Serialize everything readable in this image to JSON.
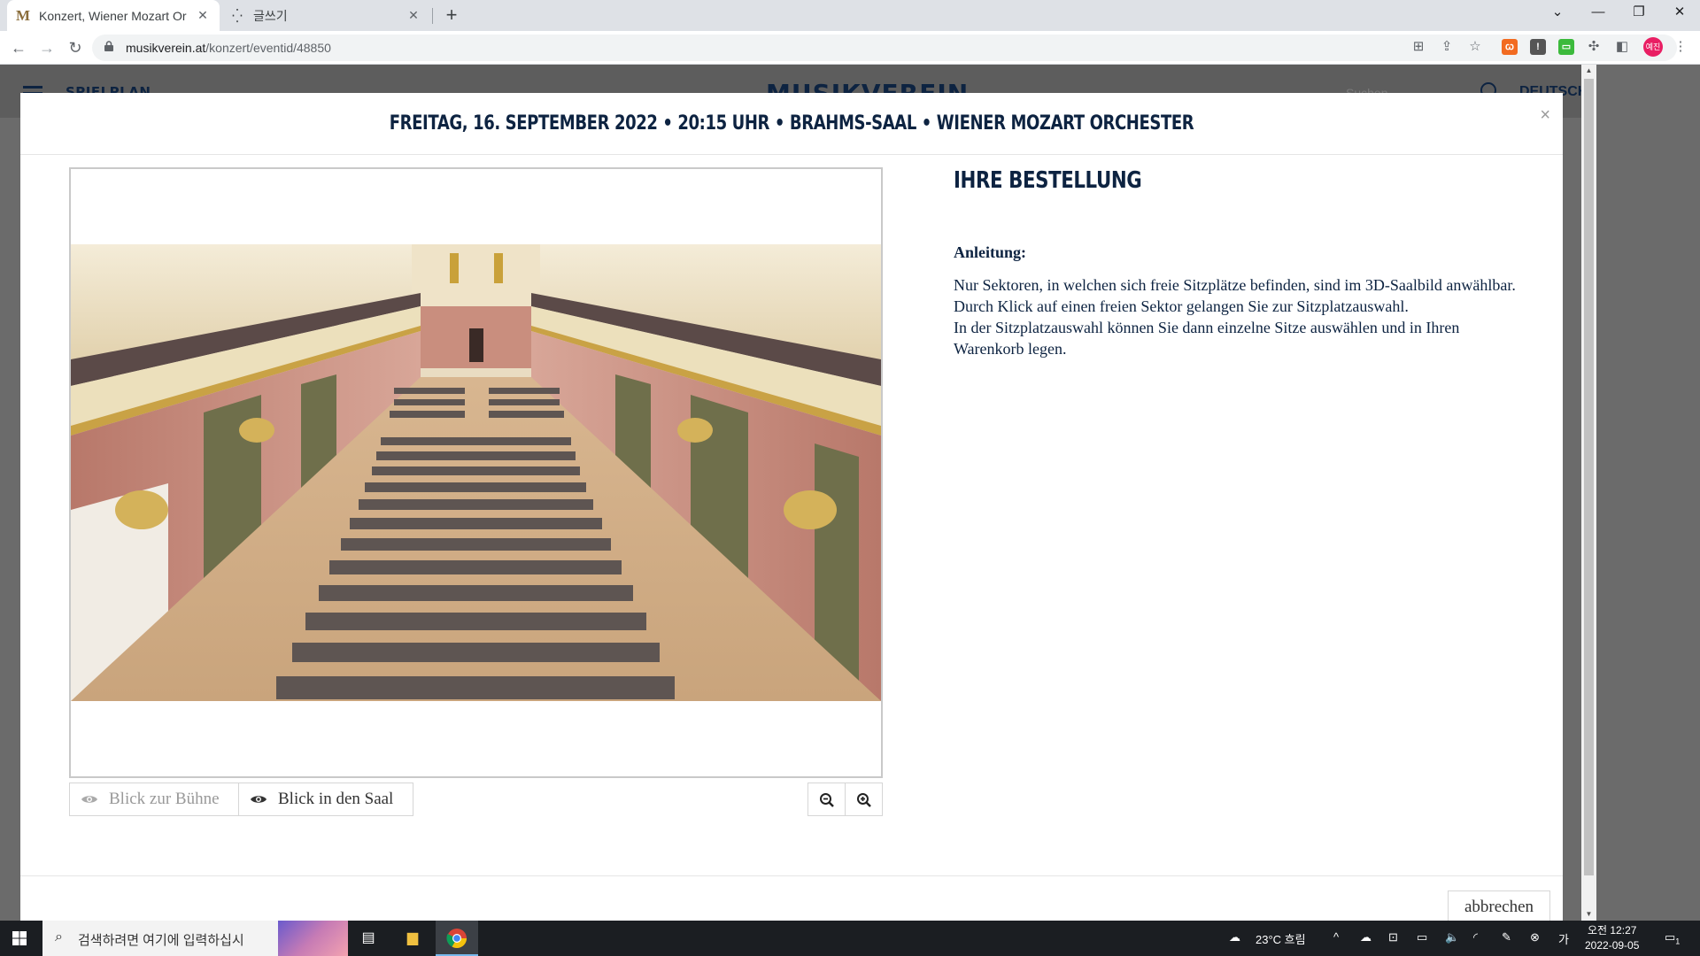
{
  "browser": {
    "tabs": [
      {
        "title": "Konzert, Wiener Mozart Or",
        "favicon": "M",
        "active": true
      },
      {
        "title": "글쓰기",
        "favicon": "⁛",
        "active": false
      }
    ],
    "url_host": "musikverein.at",
    "url_path": "/konzert/eventid/48850",
    "profile_label": "예진"
  },
  "site": {
    "menu_label": "SPIELPLAN",
    "logo": "MUSIKVEREIN",
    "search_placeholder": "Suchen",
    "language": "DEUTSCH"
  },
  "modal": {
    "title": "FREITAG, 16. SEPTEMBER 2022 • 20:15 UHR • BRAHMS-SAAL • WIENER MOZART ORCHESTER",
    "close": "×",
    "view_stage_label": "Blick zur Bühne",
    "view_hall_label": "Blick in den Saal",
    "order_heading": "IHRE BESTELLUNG",
    "instructions_label": "Anleitung:",
    "instructions_p1": "Nur Sektoren, in welchen sich freie Sitzplätze befinden, sind im 3D-Saalbild anwählbar. Durch Klick auf einen freien Sektor gelangen Sie zur Sitzplatzauswahl.",
    "instructions_p2": "In der Sitzplatzauswahl können Sie dann einzelne Sitze auswählen und in Ihren Warenkorb legen.",
    "cancel_label": "abbrechen"
  },
  "taskbar": {
    "search_placeholder": "검색하려면 여기에 입력하십시",
    "weather": "23°C  흐림",
    "time": "오전 12:27",
    "date": "2022-09-05",
    "notification_count": "1"
  },
  "colors": {
    "brand_navy": "#0d2341",
    "overlay": "#6b6b6b"
  }
}
